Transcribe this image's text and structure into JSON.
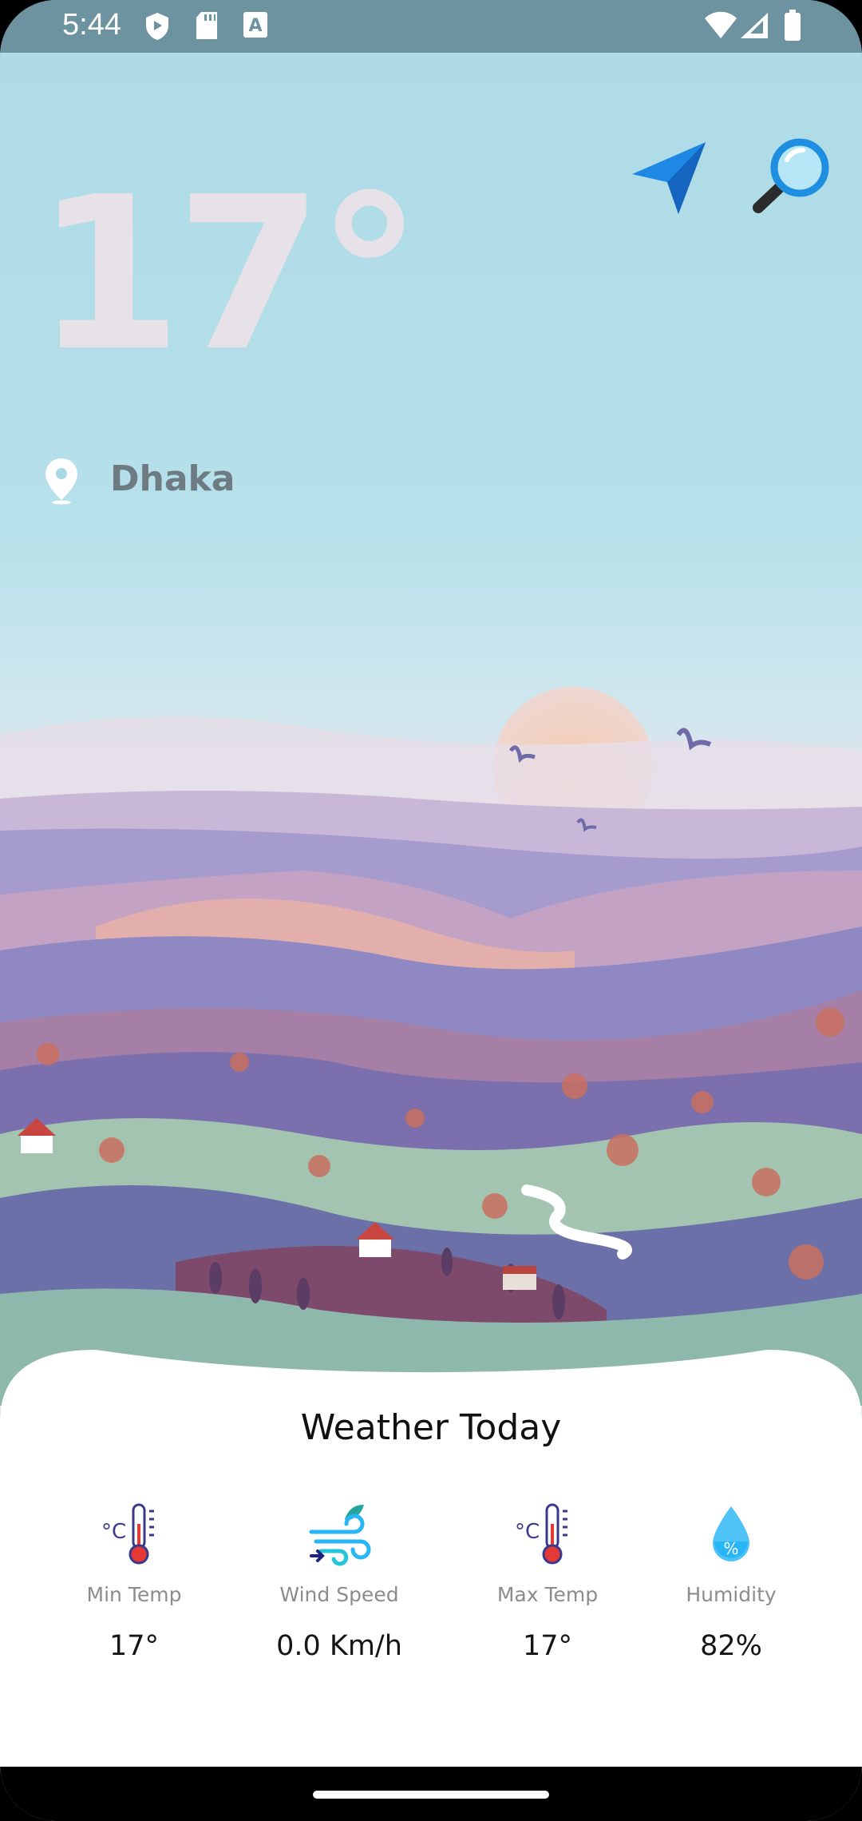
{
  "status_bar": {
    "time": "5:44",
    "icons": [
      "shield-play-icon",
      "sd-card-icon",
      "font-a-icon",
      "wifi-icon",
      "signal-icon",
      "battery-icon"
    ]
  },
  "weather": {
    "temperature": "17°",
    "city": "Dhaka"
  },
  "actions": {
    "location_icon": "navigation-arrow-icon",
    "search_icon": "magnifier-icon"
  },
  "today": {
    "title": "Weather Today",
    "stats": [
      {
        "label": "Min Temp",
        "value": "17°",
        "icon": "thermometer-icon"
      },
      {
        "label": "Wind Speed",
        "value": "0.0 Km/h",
        "icon": "wind-icon"
      },
      {
        "label": "Max Temp",
        "value": "17°",
        "icon": "thermometer-icon"
      },
      {
        "label": "Humidity",
        "value": "82%",
        "icon": "humidity-drop-icon"
      }
    ]
  },
  "colors": {
    "sky": "#aedbe6",
    "status_bar": "#6d93a0",
    "accent_blue": "#1e88e5",
    "card_bg": "#ffffff"
  }
}
